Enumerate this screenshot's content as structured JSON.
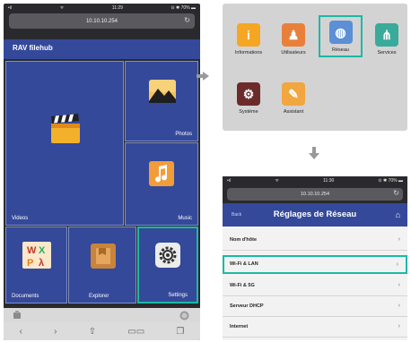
{
  "phone1": {
    "status": {
      "signal": "•ıl",
      "wifi": "ᯤ",
      "time": "11:29",
      "battery": "⊙ ✱ 70% ▬"
    },
    "url": "10.10.10.254",
    "reload_icon": "↻",
    "app_title": "RAV filehub",
    "tiles": {
      "videos": "Videos",
      "photos": "Photos",
      "music": "Music",
      "documents": "Documents",
      "explorer": "Explorer",
      "settings": "Settings"
    },
    "toolbar": [
      "‹",
      "›",
      "⇧",
      "▭▭",
      "❐"
    ]
  },
  "panel2": {
    "apps": [
      {
        "label": "Informations",
        "glyph": "i",
        "color": "#f5a623"
      },
      {
        "label": "Utilisateurs",
        "glyph": "♟",
        "color": "#e8803a"
      },
      {
        "label": "Réseau",
        "glyph": "◍",
        "color": "#5b8fd6"
      },
      {
        "label": "Services",
        "glyph": "⋔",
        "color": "#3aaa9a"
      },
      {
        "label": "Système",
        "glyph": "⚙",
        "color": "#6d2a2a"
      },
      {
        "label": "Assistant",
        "glyph": "✎",
        "color": "#f2a640"
      }
    ]
  },
  "phone2": {
    "status": {
      "signal": "•ıl",
      "wifi": "ᯤ",
      "time": "11:30",
      "battery": "⊙ ✱ 70% ▬"
    },
    "url": "10.10.10.254",
    "reload_icon": "↻",
    "back_label": "Back",
    "title": "Réglages de Réseau",
    "home_icon": "⌂",
    "rows": [
      "Nom d'hôte",
      "Wi-Fi & LAN",
      "Wi-Fi & 5G",
      "Serveur DHCP",
      "Internet"
    ],
    "chevron": "›"
  },
  "colors": {
    "hub_blue": "#34499a",
    "highlight": "#1bb9a4"
  }
}
